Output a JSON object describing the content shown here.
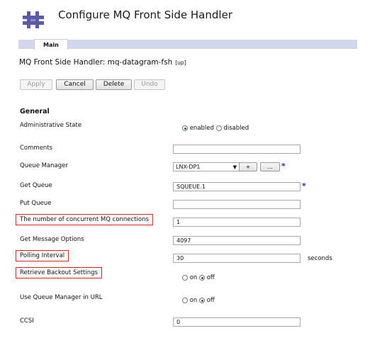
{
  "header": {
    "title": "Configure MQ Front Side Handler"
  },
  "tabs": [
    {
      "label": "Main"
    }
  ],
  "handler": {
    "label": "MQ Front Side Handler: mq-datagram-fsh",
    "status": "[up]"
  },
  "actions": {
    "apply": "Apply",
    "cancel": "Cancel",
    "delete": "Delete",
    "undo": "Undo"
  },
  "section_title": "General",
  "fields": {
    "admin_state": {
      "label": "Administrative State",
      "option_enabled": "enabled",
      "option_disabled": "disabled",
      "value": "enabled"
    },
    "comments": {
      "label": "Comments",
      "value": ""
    },
    "queue_manager": {
      "label": "Queue Manager",
      "value": "LNX-DP1",
      "add_label": "+",
      "more_label": "...",
      "required_mark": "*"
    },
    "get_queue": {
      "label": "Get Queue",
      "value": "SQUEUE.1",
      "required_mark": "*"
    },
    "put_queue": {
      "label": "Put Queue",
      "value": ""
    },
    "concurrent_connections": {
      "label": "The number of concurrent MQ connections",
      "value": "1"
    },
    "get_message_options": {
      "label": "Get Message Options",
      "value": "4097"
    },
    "polling_interval": {
      "label": "Polling Interval",
      "value": "30",
      "unit": "seconds"
    },
    "retrieve_backout": {
      "label": "Retrieve Backout Settings",
      "option_on": "on",
      "option_off": "off",
      "value": "off"
    },
    "use_qm_in_url": {
      "label": "Use Queue Manager in URL",
      "option_on": "on",
      "option_off": "off",
      "value": "off"
    },
    "ccsi": {
      "label": "CCSI",
      "value": "0"
    }
  },
  "colors": {
    "highlight_border": "#e02020",
    "tab_strip": "#d3d7ee",
    "logo": "#5b5aa8",
    "required": "#2233aa"
  }
}
